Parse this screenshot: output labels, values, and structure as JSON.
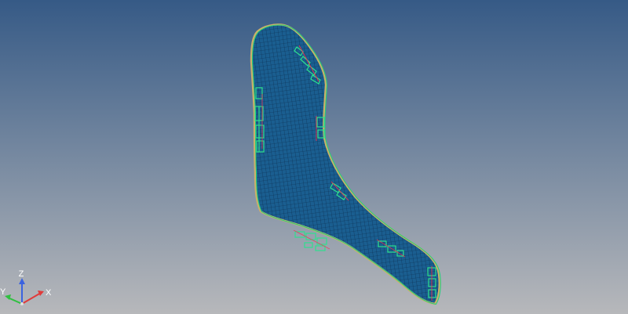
{
  "viewport": {
    "background_top": "#365a86",
    "background_bottom": "#b7b8bb"
  },
  "model": {
    "shell_fill": "#1a5e90",
    "mesh_line": "#0b2b4c",
    "outline_outer": "#c9b06a",
    "outline_inner": "#1fd17a",
    "edge_accent": "#ff2a4a",
    "feature_color": "#2ee08e"
  },
  "triad": {
    "z_label": "Z",
    "x_label": "X",
    "y_label": "Y",
    "z_color": "#3b63e0",
    "x_color": "#e03a3a",
    "y_color": "#30c040"
  }
}
